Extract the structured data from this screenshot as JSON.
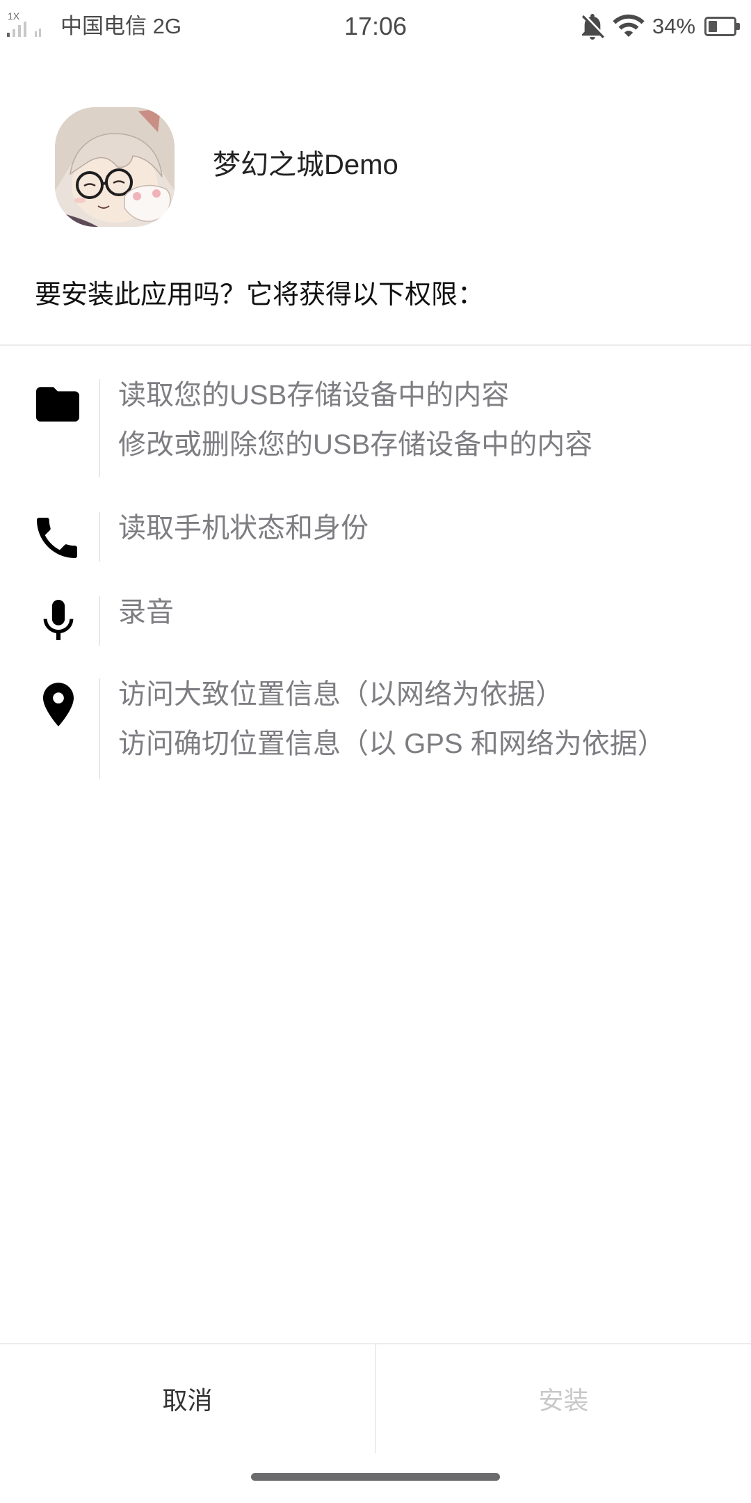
{
  "status_bar": {
    "network_type": "1X",
    "carrier": "中国电信 2G",
    "time": "17:06",
    "battery_percent": "34%",
    "battery_level": 0.34,
    "icons": {
      "signal": "signal-icon",
      "mute": "notifications-off-icon",
      "wifi": "wifi-icon",
      "battery": "battery-icon"
    }
  },
  "app": {
    "name": "梦幻之城Demo",
    "icon": "app-icon"
  },
  "install_prompt": "要安装此应用吗？它将获得以下权限：",
  "permissions": [
    {
      "icon": "folder-icon",
      "lines": [
        "读取您的USB存储设备中的内容",
        "修改或删除您的USB存储设备中的内容"
      ]
    },
    {
      "icon": "phone-icon",
      "lines": [
        "读取手机状态和身份"
      ]
    },
    {
      "icon": "microphone-icon",
      "lines": [
        "录音"
      ]
    },
    {
      "icon": "location-pin-icon",
      "lines": [
        "访问大致位置信息（以网络为依据）",
        "访问确切位置信息（以 GPS 和网络为依据）"
      ]
    }
  ],
  "actions": {
    "cancel_label": "取消",
    "install_label": "安装",
    "install_enabled": false
  },
  "colors": {
    "background": "#ffffff",
    "text_primary": "#222222",
    "text_secondary": "#7d7d82",
    "text_disabled": "#c8c8c8",
    "divider": "#ececec"
  }
}
